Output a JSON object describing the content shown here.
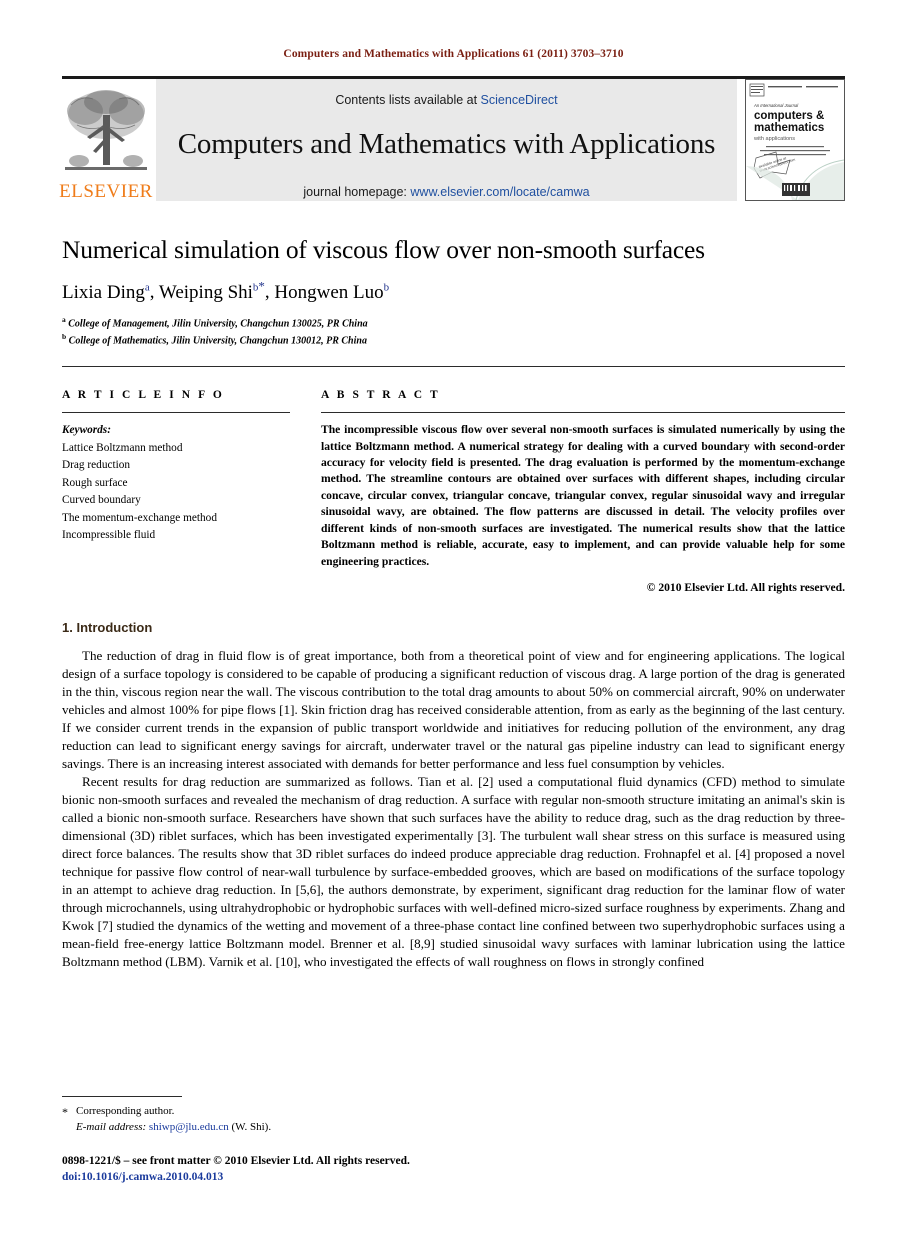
{
  "running_head": "Computers and Mathematics with Applications 61 (2011) 3703–3710",
  "masthead": {
    "publisher_wordmark": "ELSEVIER",
    "contents_prefix": "Contents lists available at ",
    "contents_link": "ScienceDirect",
    "journal_title": "Computers and Mathematics with Applications",
    "homepage_prefix": "journal homepage: ",
    "homepage_link": "www.elsevier.com/locate/camwa",
    "cover": {
      "line1": "An International Journal",
      "line2": "computers &",
      "line3": "mathematics",
      "line4": "with applications",
      "line5": "EDITOR-IN-CHIEF:  E.Y. RODIN",
      "badge": "available online at www.sciencedirect.com"
    }
  },
  "article": {
    "title": "Numerical simulation of viscous flow over non-smooth surfaces",
    "authors": [
      {
        "name": "Lixia Ding",
        "sup": "a",
        "star": false,
        "sep": ", "
      },
      {
        "name": "Weiping Shi",
        "sup": "b",
        "star": true,
        "sep": ", "
      },
      {
        "name": "Hongwen Luo",
        "sup": "b",
        "star": false,
        "sep": ""
      }
    ],
    "affiliations": [
      {
        "marker": "a",
        "text": "College of Management, Jilin University, Changchun 130025, PR China"
      },
      {
        "marker": "b",
        "text": "College of Mathematics, Jilin University, Changchun 130012, PR China"
      }
    ]
  },
  "article_info": {
    "heading": "A R T I C L E    I N F O",
    "keywords_label": "Keywords:",
    "keywords": [
      "Lattice Boltzmann method",
      "Drag reduction",
      "Rough surface",
      "Curved boundary",
      "The momentum-exchange method",
      "Incompressible fluid"
    ]
  },
  "abstract": {
    "heading": "A B S T R A C T",
    "text": "The incompressible viscous flow over several non-smooth surfaces is simulated numerically by using the lattice Boltzmann method. A numerical strategy for dealing with a curved boundary with second-order accuracy for velocity field is presented. The drag evaluation is performed by the momentum-exchange method. The streamline contours are obtained over surfaces with different shapes, including circular concave, circular convex, triangular concave, triangular convex, regular sinusoidal wavy and irregular sinusoidal wavy, are obtained. The flow patterns are discussed in detail. The velocity profiles over different kinds of non-smooth surfaces are investigated. The numerical results show that the lattice Boltzmann method is reliable, accurate, easy to implement, and can provide valuable help for some engineering practices.",
    "copyright": "© 2010 Elsevier Ltd. All rights reserved."
  },
  "introduction": {
    "heading": "1. Introduction",
    "paragraph1": "The reduction of drag in fluid flow is of great importance, both from a theoretical point of view and for engineering applications. The logical design of a surface topology is considered to be capable of producing a significant reduction of viscous drag. A large portion of the drag is generated in the thin, viscous region near the wall. The viscous contribution to the total drag amounts to about 50% on commercial aircraft, 90% on underwater vehicles and almost 100% for pipe flows [1]. Skin friction drag has received considerable attention, from as early as the beginning of the last century. If we consider current trends in the expansion of public transport worldwide and initiatives for reducing pollution of the environment, any drag reduction can lead to significant energy savings for aircraft, underwater travel or the natural gas pipeline industry can lead to significant energy savings. There is an increasing interest associated with demands for better performance and less fuel consumption by vehicles.",
    "paragraph2": "Recent results for drag reduction are summarized as follows. Tian et al. [2] used a computational fluid dynamics (CFD) method to simulate bionic non-smooth surfaces and revealed the mechanism of drag reduction. A surface with regular non-smooth structure imitating an animal's skin is called a bionic non-smooth surface. Researchers have shown that such surfaces have the ability to reduce drag, such as the drag reduction by three-dimensional (3D) riblet surfaces, which has been investigated experimentally [3]. The turbulent wall shear stress on this surface is measured using direct force balances. The results show that 3D riblet surfaces do indeed produce appreciable drag reduction. Frohnapfel et al. [4] proposed a novel technique for passive flow control of near-wall turbulence by surface-embedded grooves, which are based on modifications of the surface topology in an attempt to achieve drag reduction. In [5,6], the authors demonstrate, by experiment, significant drag reduction for the laminar flow of water through microchannels, using ultrahydrophobic or hydrophobic surfaces with well-defined micro-sized surface roughness by experiments. Zhang and Kwok [7] studied the dynamics of the wetting and movement of a three-phase contact line confined between two superhydrophobic surfaces using a mean-field free-energy lattice Boltzmann model. Brenner et al. [8,9] studied sinusoidal wavy surfaces with laminar lubrication using the lattice Boltzmann method (LBM). Varnik et al. [10], who investigated the effects of wall roughness on flows in strongly confined"
  },
  "footnotes": {
    "star_mark": "*",
    "corresponding": "Corresponding author.",
    "email_label": "E-mail address:",
    "email": "shiwp@jlu.edu.cn",
    "email_suffix": "(W. Shi).",
    "issn_line": "0898-1221/$ – see front matter © 2010 Elsevier Ltd. All rights reserved.",
    "doi_line": "doi:10.1016/j.camwa.2010.04.013"
  },
  "colors": {
    "running_head": "#7a1f12",
    "link": "#2050a0",
    "reference": "#1a3a9c",
    "elsevier_orange": "#ef7c1a",
    "masthead_bg": "#e9e9e9",
    "heading_brown": "#3b2a17"
  }
}
